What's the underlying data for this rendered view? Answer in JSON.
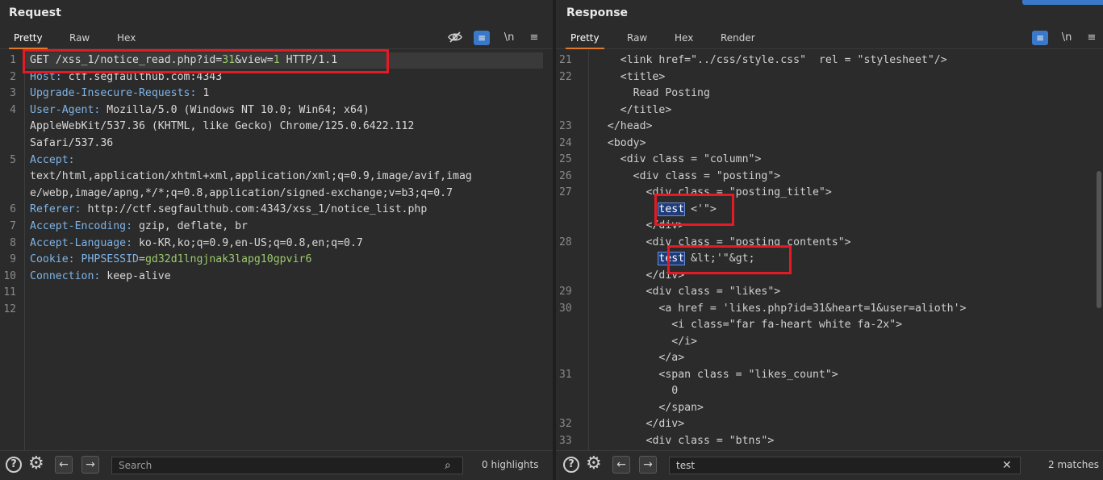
{
  "request": {
    "title": "Request",
    "tabs": [
      "Pretty",
      "Raw",
      "Hex"
    ],
    "tools": {
      "eye_off": "eye-off",
      "wrap": "≡",
      "newline": "\\n",
      "menu": "≡"
    },
    "lines": [
      {
        "n": "1",
        "k": "GET ",
        "path": "/xss_1/notice_read.php?id=",
        "id": "31",
        "amp": "&view=",
        "view": "1",
        "tail": " HTTP/1.1"
      },
      {
        "n": "2",
        "k": "Host: ",
        "v": "ctf.segfaulthub.com:4343"
      },
      {
        "n": "3",
        "k": "Upgrade-Insecure-Requests: ",
        "v": "1"
      },
      {
        "n": "4",
        "k": "User-Agent: ",
        "v": "Mozilla/5.0 (Windows NT 10.0; Win64; x64)"
      },
      {
        "n": "",
        "k": "",
        "v": "AppleWebKit/537.36 (KHTML, like Gecko) Chrome/125.0.6422.112"
      },
      {
        "n": "",
        "k": "",
        "v": "Safari/537.36"
      },
      {
        "n": "5",
        "k": "Accept: ",
        "v": ""
      },
      {
        "n": "",
        "k": "",
        "v": "text/html,application/xhtml+xml,application/xml;q=0.9,image/avif,imag"
      },
      {
        "n": "",
        "k": "",
        "v": "e/webp,image/apng,*/*;q=0.8,application/signed-exchange;v=b3;q=0.7"
      },
      {
        "n": "6",
        "k": "Referer: ",
        "v": "http://ctf.segfaulthub.com:4343/xss_1/notice_list.php"
      },
      {
        "n": "7",
        "k": "Accept-Encoding: ",
        "v": "gzip, deflate, br"
      },
      {
        "n": "8",
        "k": "Accept-Language: ",
        "v": "ko-KR,ko;q=0.9,en-US;q=0.8,en;q=0.7"
      },
      {
        "n": "9",
        "k": "Cookie: ",
        "ck": "PHPSESSID",
        "eq": "=",
        "cv": "gd32d1lngjnak3lapg10gpvir6"
      },
      {
        "n": "10",
        "k": "Connection: ",
        "v": "keep-alive"
      },
      {
        "n": "11",
        "k": "",
        "v": ""
      },
      {
        "n": "12",
        "k": "",
        "v": ""
      }
    ],
    "search": {
      "placeholder": "Search",
      "value": "",
      "count": "0 highlights"
    }
  },
  "response": {
    "title": "Response",
    "tabs": [
      "Pretty",
      "Raw",
      "Hex",
      "Render"
    ],
    "tools": {
      "wrap": "≡",
      "newline": "\\n",
      "menu": "≡"
    },
    "lines": [
      {
        "n": "21",
        "t": "    <link href=\"../css/style.css\"  rel = \"stylesheet\"/>"
      },
      {
        "n": "22",
        "t": "    <title>"
      },
      {
        "n": "",
        "t": "      Read Posting"
      },
      {
        "n": "",
        "t": "    </title>"
      },
      {
        "n": "23",
        "t": "  </head>"
      },
      {
        "n": "24",
        "t": "  <body>"
      },
      {
        "n": "25",
        "t": "    <div class = \"column\">"
      },
      {
        "n": "26",
        "t": "      <div class = \"posting\">"
      },
      {
        "n": "27",
        "t": "        <div class = \"posting_title\">"
      },
      {
        "n": "",
        "pre": "          ",
        "m": "test",
        "post": " <'\">"
      },
      {
        "n": "",
        "t": "        </div>"
      },
      {
        "n": "28",
        "t": "        <div class = \"posting_contents\">"
      },
      {
        "n": "",
        "pre": "          ",
        "m": "test",
        "post": " &lt;'\"&gt;"
      },
      {
        "n": "",
        "t": "        </div>"
      },
      {
        "n": "29",
        "t": "        <div class = \"likes\">"
      },
      {
        "n": "30",
        "t": "          <a href = 'likes.php?id=31&heart=1&user=alioth'>"
      },
      {
        "n": "",
        "t": "            <i class=\"far fa-heart white fa-2x\">"
      },
      {
        "n": "",
        "t": "            </i>"
      },
      {
        "n": "",
        "t": "          </a>"
      },
      {
        "n": "31",
        "t": "          <span class = \"likes_count\">"
      },
      {
        "n": "",
        "t": "            0"
      },
      {
        "n": "",
        "t": "          </span>"
      },
      {
        "n": "32",
        "t": "        </div>"
      },
      {
        "n": "33",
        "t": "        <div class = \"btns\">"
      }
    ],
    "search": {
      "placeholder": "Search",
      "value": "test",
      "clear": "✕",
      "count": "2 matches"
    }
  }
}
